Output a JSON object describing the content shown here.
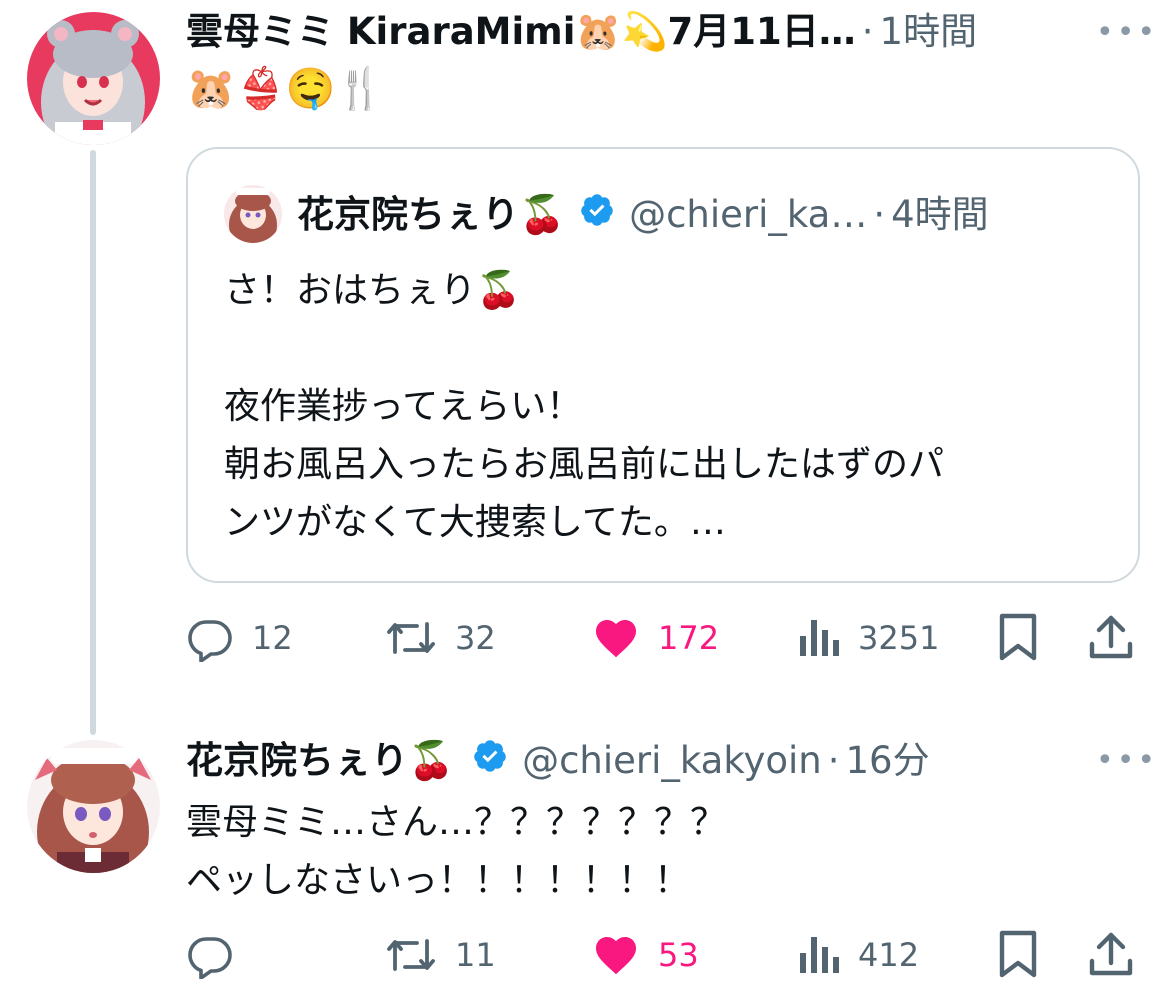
{
  "tweet1": {
    "display_name": "雲母ミミ KiraraMimi🐹💫7月11日…",
    "time": "1時間",
    "text": "🐹👙🤤🍴",
    "quote": {
      "display_name": "花京院ちぇり🍒",
      "handle": "@chieri_ka…",
      "time": "4時間",
      "lines": [
        "さ！おはちぇり🍒",
        "",
        "夜作業捗ってえらい！",
        "朝お風呂入ったらお風呂前に出したはずのパ",
        "ンツがなくて大捜索してた。…"
      ]
    },
    "actions": {
      "replies": "12",
      "retweets": "32",
      "likes": "172",
      "views": "3251"
    }
  },
  "tweet2": {
    "display_name": "花京院ちぇり🍒",
    "handle": "@chieri_kakyoin",
    "time": "16分",
    "lines": [
      "雲母ミミ…さん…？？？？？？？",
      "ペッしなさいっ！！！！！！！"
    ],
    "actions": {
      "replies": "",
      "retweets": "11",
      "likes": "53",
      "views": "412"
    }
  },
  "separator": "·",
  "colors": {
    "like": "#f91880",
    "muted": "#536471",
    "verified": "#1d9bf0",
    "border": "#cfd9de"
  },
  "icons": [
    "reply-icon",
    "retweet-icon",
    "heart-icon",
    "views-icon",
    "bookmark-icon",
    "share-icon",
    "more-icon",
    "verified-badge-icon"
  ]
}
